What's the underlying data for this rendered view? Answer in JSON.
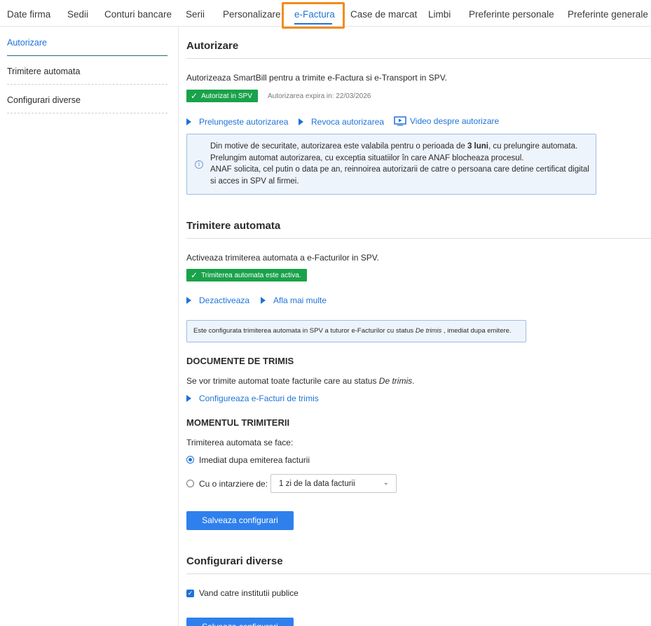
{
  "tabs": [
    {
      "label": "Date firma"
    },
    {
      "label": "Sedii"
    },
    {
      "label": "Conturi bancare"
    },
    {
      "label": "Serii"
    },
    {
      "label": "Personalizare"
    },
    {
      "label": "e-Factura"
    },
    {
      "label": "Case de marcat"
    },
    {
      "label": "Limbi"
    },
    {
      "label": "Preferinte personale"
    },
    {
      "label": "Preferinte generale"
    }
  ],
  "sidebar": {
    "items": [
      {
        "label": "Autorizare"
      },
      {
        "label": "Trimitere automata"
      },
      {
        "label": "Configurari diverse"
      }
    ]
  },
  "autorizare": {
    "title": "Autorizare",
    "description": "Autorizeaza SmartBill pentru a trimite e-Factura si e-Transport in SPV.",
    "badge": "Autorizat in SPV",
    "expiry": "Autorizarea expira in: 22/03/2026",
    "links": {
      "extend": "Prelungeste autorizarea",
      "revoke": "Revoca autorizarea",
      "video": "Video despre autorizare"
    },
    "info": {
      "line1_a": "Din motive de securitate, autorizarea este valabila pentru o perioada de ",
      "line1_b": "3 luni",
      "line1_c": ", cu prelungire automata.",
      "line2": "Prelungim automat autorizarea, cu exceptia situatiilor în care ANAF blocheaza procesul.",
      "line3": "ANAF solicita, cel putin o data pe an, reinnoirea autorizarii de catre o persoana care detine certificat digital",
      "line4": "si acces in SPV al firmei."
    }
  },
  "trimitere": {
    "title": "Trimitere automata",
    "description": "Activeaza trimiterea automata a e-Facturilor in SPV.",
    "badge": "Trimiterea automata este activa.",
    "links": {
      "deactivate": "Dezactiveaza",
      "more": "Afla mai multe"
    },
    "note_a": "Este configurata trimiterea automata in SPV a tuturor e-Facturilor cu status ",
    "note_b": "De trimis",
    "note_c": " , imediat dupa emitere.",
    "documente": {
      "title": "DOCUMENTE DE TRIMIS",
      "text_a": "Se vor trimite automat toate facturile care au status ",
      "text_b": "De trimis",
      "text_c": ".",
      "link": "Configureaza e-Facturi de trimis"
    },
    "moment": {
      "title": "MOMENTUL TRIMITERII",
      "text": "Trimiterea automata se face:",
      "option1": "Imediat dupa emiterea facturii",
      "option2": "Cu o intarziere de:",
      "select_value": "1 zi de la data facturii"
    },
    "save": "Salveaza configurari"
  },
  "configurari": {
    "title": "Configurari diverse",
    "checkbox_label": "Vand catre institutii publice",
    "save": "Salveaza configurari"
  },
  "colors": {
    "accent": "#1e73d8",
    "success": "#19a24a",
    "highlight": "#f28c1a",
    "button": "#2f80ed"
  }
}
